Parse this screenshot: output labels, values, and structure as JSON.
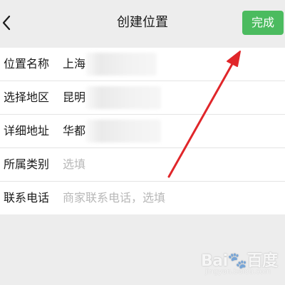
{
  "header": {
    "back_icon": "chevron-left-icon",
    "title": "创建位置",
    "done_label": "完成",
    "done_color": "#4bbb5f"
  },
  "form": {
    "rows": [
      {
        "label": "位置名称",
        "value": "上海",
        "placeholder": ""
      },
      {
        "label": "选择地区",
        "value": "昆明",
        "placeholder": ""
      },
      {
        "label": "详细地址",
        "value": "华都",
        "placeholder": ""
      },
      {
        "label": "所属类别",
        "value": "",
        "placeholder": "选填"
      },
      {
        "label": "联系电话",
        "value": "",
        "placeholder": "商家联系电话，选填"
      }
    ]
  },
  "annotation": {
    "arrow_color": "#e0262a",
    "arrow_icon": "red-arrow-pointer"
  },
  "watermark": {
    "logo_text": "Bai🐾百度",
    "sub_text": "jingyan.baidu.com"
  }
}
